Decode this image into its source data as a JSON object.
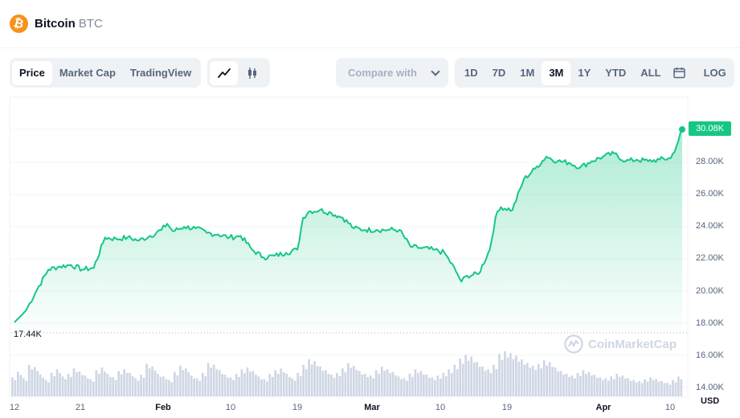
{
  "coin": {
    "name": "Bitcoin",
    "symbol": "BTC",
    "logo_glyph": "₿",
    "logo_color": "#f7931a"
  },
  "toolbar": {
    "view_tabs": [
      "Price",
      "Market Cap",
      "TradingView"
    ],
    "active_view": "Price",
    "chart_type_icons": [
      "line-chart-icon",
      "candlestick-icon"
    ],
    "compare_placeholder": "Compare with",
    "ranges": [
      "1D",
      "7D",
      "1M",
      "3M",
      "1Y",
      "YTD",
      "ALL"
    ],
    "active_range": "3M",
    "log_label": "LOG"
  },
  "price_badge": "30.08K",
  "min_label": "17.44K",
  "currency_label": "USD",
  "watermark": "CoinMarketCap",
  "colors": {
    "up": "#16c784",
    "volume": "#cfd6e4"
  },
  "chart_data": {
    "type": "area",
    "y_tick_labels": [
      "30.08K",
      "28.00K",
      "26.00K",
      "24.00K",
      "22.00K",
      "20.00K",
      "18.00K",
      "16.00K",
      "14.00K"
    ],
    "x_tick_labels": [
      "12",
      "21",
      "Feb",
      "10",
      "19",
      "Mar",
      "10",
      "19",
      "Apr",
      "10"
    ],
    "ylim": [
      14000,
      30500
    ],
    "price_points": [
      [
        0,
        17.44
      ],
      [
        2,
        18.2
      ],
      [
        4,
        19.6
      ],
      [
        6,
        20.9
      ],
      [
        8,
        21.1
      ],
      [
        10,
        21.2
      ],
      [
        12,
        20.9
      ],
      [
        14,
        21.0
      ],
      [
        16,
        23.0
      ],
      [
        18,
        22.9
      ],
      [
        20,
        23.0
      ],
      [
        22,
        22.8
      ],
      [
        24,
        23.1
      ],
      [
        26,
        23.5
      ],
      [
        27,
        23.9
      ],
      [
        28,
        23.4
      ],
      [
        30,
        23.7
      ],
      [
        32,
        23.6
      ],
      [
        34,
        23.3
      ],
      [
        36,
        23.2
      ],
      [
        38,
        23.0
      ],
      [
        40,
        23.1
      ],
      [
        42,
        22.2
      ],
      [
        44,
        21.7
      ],
      [
        46,
        21.8
      ],
      [
        48,
        22.0
      ],
      [
        50,
        22.2
      ],
      [
        51,
        24.3
      ],
      [
        52,
        24.7
      ],
      [
        54,
        24.8
      ],
      [
        56,
        24.6
      ],
      [
        58,
        24.3
      ],
      [
        60,
        23.6
      ],
      [
        62,
        23.5
      ],
      [
        64,
        23.5
      ],
      [
        66,
        23.5
      ],
      [
        68,
        23.5
      ],
      [
        70,
        22.4
      ],
      [
        72,
        22.3
      ],
      [
        74,
        22.2
      ],
      [
        76,
        22.0
      ],
      [
        78,
        20.8
      ],
      [
        79,
        20.1
      ],
      [
        80,
        20.5
      ],
      [
        82,
        20.6
      ],
      [
        84,
        22.2
      ],
      [
        85,
        24.3
      ],
      [
        86,
        25.0
      ],
      [
        88,
        24.8
      ],
      [
        90,
        26.8
      ],
      [
        92,
        27.5
      ],
      [
        94,
        28.3
      ],
      [
        96,
        28.0
      ],
      [
        98,
        27.9
      ],
      [
        100,
        27.6
      ],
      [
        102,
        28.0
      ],
      [
        104,
        28.3
      ],
      [
        106,
        28.5
      ],
      [
        108,
        28.0
      ],
      [
        110,
        28.1
      ],
      [
        112,
        28.0
      ],
      [
        114,
        28.1
      ],
      [
        116,
        28.2
      ],
      [
        117,
        29.0
      ],
      [
        118,
        30.08
      ]
    ],
    "x_days_total": 118,
    "volume_relative": [
      0.42,
      0.55,
      0.4,
      0.7,
      0.65,
      0.48,
      0.36,
      0.52,
      0.6,
      0.44,
      0.5,
      0.62,
      0.55,
      0.46,
      0.38,
      0.58,
      0.64,
      0.5,
      0.42,
      0.56,
      0.6,
      0.52,
      0.4,
      0.48,
      0.72,
      0.66,
      0.5,
      0.44,
      0.36,
      0.54,
      0.68,
      0.62,
      0.46,
      0.4,
      0.52,
      0.74,
      0.7,
      0.58,
      0.48,
      0.42,
      0.5,
      0.6,
      0.64,
      0.56,
      0.44,
      0.38,
      0.5,
      0.58,
      0.62,
      0.5,
      0.4,
      0.52,
      0.7,
      0.82,
      0.78,
      0.66,
      0.58,
      0.48,
      0.52,
      0.62,
      0.74,
      0.68,
      0.56,
      0.5,
      0.46,
      0.58,
      0.66,
      0.6,
      0.54,
      0.44,
      0.4,
      0.5,
      0.6,
      0.56,
      0.48,
      0.42,
      0.46,
      0.52,
      0.6,
      0.7,
      0.84,
      0.92,
      0.88,
      0.76,
      0.66,
      0.6,
      0.7,
      0.94,
      1.0,
      0.96,
      0.9,
      0.82,
      0.74,
      0.68,
      0.72,
      0.8,
      0.76,
      0.64,
      0.56,
      0.5,
      0.46,
      0.52,
      0.58,
      0.54,
      0.48,
      0.42,
      0.4,
      0.44,
      0.5,
      0.46,
      0.4,
      0.36,
      0.34,
      0.38,
      0.42,
      0.38,
      0.34,
      0.3,
      0.36,
      0.44
    ]
  }
}
